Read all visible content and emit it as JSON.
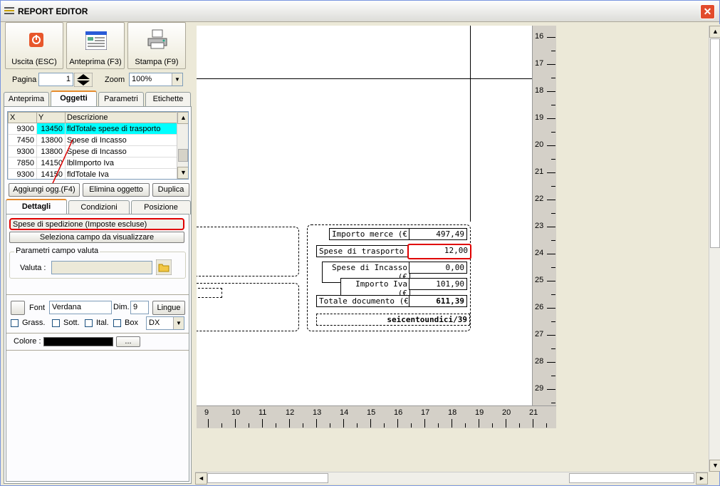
{
  "app": {
    "title": "REPORT EDITOR"
  },
  "toolbar": {
    "exit_label": "Uscita (ESC)",
    "preview_label": "Anteprima (F3)",
    "print_label": "Stampa (F9)"
  },
  "pagina": {
    "label": "Pagina",
    "value": "1"
  },
  "zoom": {
    "label": "Zoom",
    "value": "100%"
  },
  "top_tabs": [
    "Anteprima",
    "Oggetti",
    "Parametri",
    "Etichette"
  ],
  "object_table": {
    "headers": [
      "X",
      "Y",
      "Descrizione"
    ],
    "rows": [
      {
        "x": "9300",
        "y": "13450",
        "desc": "fldTotale spese di trasporto"
      },
      {
        "x": "7450",
        "y": "13800",
        "desc": "Spese di Incasso"
      },
      {
        "x": "9300",
        "y": "13800",
        "desc": "Spese di Incasso"
      },
      {
        "x": "7850",
        "y": "14150",
        "desc": "lblImporto Iva"
      },
      {
        "x": "9300",
        "y": "14150",
        "desc": "fldTotale Iva"
      }
    ]
  },
  "object_buttons": {
    "add": "Aggiungi ogg.(F4)",
    "delete": "Elimina oggetto",
    "duplicate": "Duplica"
  },
  "detail_tabs": [
    "Dettagli",
    "Condizioni",
    "Posizione"
  ],
  "details": {
    "field_value": "Spese di spedizione (Imposte escluse)",
    "select_field_button": "Seleziona campo da visualizzare",
    "currency_group": "Parametri campo valuta",
    "currency_label": "Valuta :",
    "currency_value": ""
  },
  "font": {
    "label": "Font",
    "name": "Verdana",
    "dim_label": "Dim.",
    "dim": "9",
    "lang_button": "Lingue",
    "bold": "Grass.",
    "underline": "Sott.",
    "italic": "Ital.",
    "box": "Box",
    "align": "DX"
  },
  "color": {
    "label": "Colore :",
    "button": "...",
    "value": "#000000"
  },
  "report": {
    "rows": [
      {
        "label": "Importo merce (€",
        "value": "497,49"
      },
      {
        "label": "Spese di trasporto (€",
        "value": "12,00"
      },
      {
        "label": "Spese di Incasso (€",
        "value": "0,00"
      },
      {
        "label": "Importo Iva (€",
        "value": "101,90"
      },
      {
        "label": "Totale documento (€",
        "value": "611,39"
      }
    ],
    "words": "seicentoundici/39"
  },
  "rulers": {
    "vertical": [
      "16",
      "17",
      "18",
      "19",
      "20",
      "21",
      "22",
      "23",
      "24",
      "25",
      "26",
      "27",
      "28",
      "29"
    ],
    "horizontal": [
      "9",
      "10",
      "11",
      "12",
      "13",
      "14",
      "15",
      "16",
      "17",
      "18",
      "19",
      "20",
      "21"
    ]
  },
  "colors": {
    "highlight_row": "#00ffff",
    "annotation": "#e00000"
  }
}
